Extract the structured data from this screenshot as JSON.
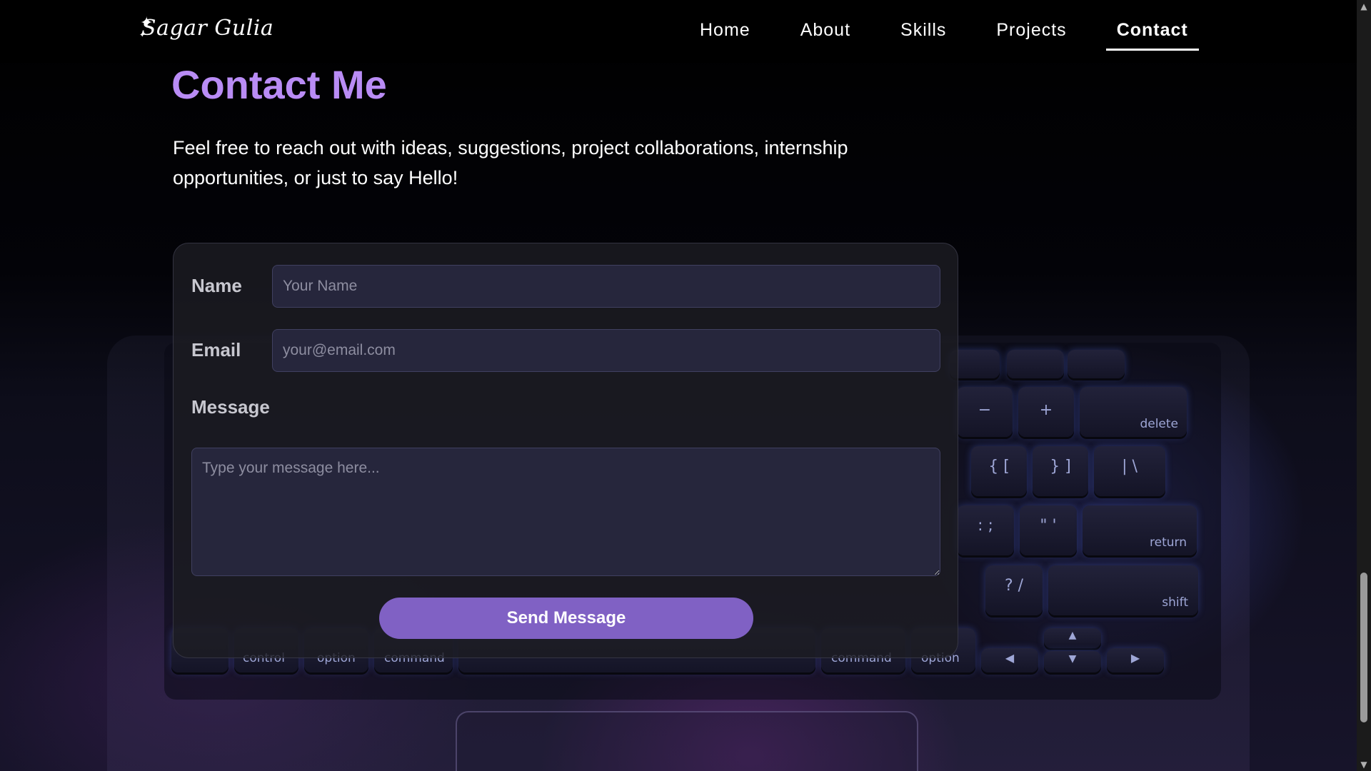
{
  "nav": {
    "logo": "Sagar Gulia",
    "links": [
      {
        "label": "Home"
      },
      {
        "label": "About"
      },
      {
        "label": "Skills"
      },
      {
        "label": "Projects"
      },
      {
        "label": "Contact",
        "active": true
      }
    ]
  },
  "contact": {
    "title": "Contact Me",
    "intro": "Feel free to reach out with ideas, suggestions, project collaborations, internship opportunities, or just to say Hello!",
    "form": {
      "name_label": "Name",
      "name_placeholder": "Your Name",
      "email_label": "Email",
      "email_placeholder": "your@email.com",
      "message_label": "Message",
      "message_placeholder": "Type your message here...",
      "submit_label": "Send Message"
    }
  },
  "background_keys": {
    "control": "control",
    "option_left": "option",
    "command_left": "command",
    "command_right": "command",
    "option_right": "option",
    "delete": "delete",
    "return": "return",
    "shift": "shift"
  },
  "colors": {
    "accent": "#b98cf5",
    "button": "#8061c4",
    "card": "#1c1c22",
    "input": "#26263c"
  }
}
